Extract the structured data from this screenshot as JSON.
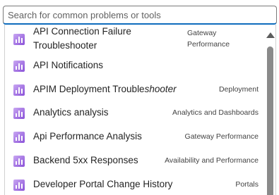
{
  "search": {
    "placeholder": "Search for common problems or tools",
    "value": ""
  },
  "items": [
    {
      "name": "API Connection Failure Troubleshooter",
      "category": "Gateway Performance",
      "icon": "chart-bar-icon"
    },
    {
      "name": "API Notifications",
      "category": "",
      "icon": "chart-bar-icon"
    },
    {
      "name_main": "APIM Deployment Trouble",
      "name_italic": "shooter",
      "category": "Deployment",
      "icon": "chart-bar-icon"
    },
    {
      "name": "Analytics analysis",
      "category": "Analytics and Dashboards",
      "icon": "chart-bar-icon"
    },
    {
      "name": "Api Performance Analysis",
      "category": "Gateway Performance",
      "icon": "chart-bar-icon"
    },
    {
      "name": "Backend 5xx Responses",
      "category": "Availability and Performance",
      "icon": "chart-bar-icon"
    },
    {
      "name": "Developer Portal Change History",
      "category": "Portals",
      "icon": "chart-bar-icon"
    }
  ],
  "colors": {
    "accent": "#0f6cbd",
    "icon_purple": "#8a52d8",
    "scrollbar_thumb": "#8a8a8a"
  }
}
